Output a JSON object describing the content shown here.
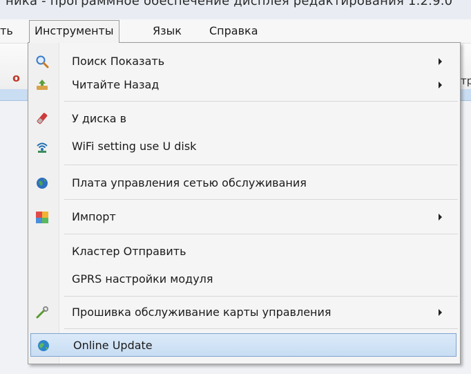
{
  "window": {
    "title_fragment": "ника - программное обеспечение дисплея редактирования 1.2.9.0"
  },
  "menubar": {
    "items": [
      {
        "label": "ть"
      },
      {
        "label": "Инструменты"
      },
      {
        "label": "Язык"
      },
      {
        "label": "Справка"
      }
    ]
  },
  "toolbar": {
    "left_fragment": "о",
    "right_fragment": "тр"
  },
  "tools_menu": {
    "items": [
      {
        "label": "Поиск Показать",
        "icon": "search-icon",
        "has_submenu": true
      },
      {
        "label": "Читайте Назад",
        "icon": "read-back-icon",
        "has_submenu": true
      },
      {
        "label": "У диска в",
        "icon": "usb-disk-icon",
        "has_submenu": false
      },
      {
        "label": "WiFi setting use U disk",
        "icon": "wifi-icon",
        "has_submenu": false
      },
      {
        "label": "Плата управления сетью обслуживания",
        "icon": "globe-icon",
        "has_submenu": false
      },
      {
        "label": "Импорт",
        "icon": "import-icon",
        "has_submenu": true
      },
      {
        "label": "Кластер Отправить",
        "icon": "",
        "has_submenu": false
      },
      {
        "label": "GPRS настройки модуля",
        "icon": "",
        "has_submenu": false
      },
      {
        "label": "Прошивка обслуживание карты управления",
        "icon": "firmware-icon",
        "has_submenu": true
      },
      {
        "label": "Online Update",
        "icon": "update-globe-icon",
        "has_submenu": false,
        "highlighted": true
      }
    ]
  },
  "colors": {
    "highlight_fill": "#c8ddf3",
    "highlight_border": "#7da2ce",
    "menu_background": "#f5f5f5"
  }
}
